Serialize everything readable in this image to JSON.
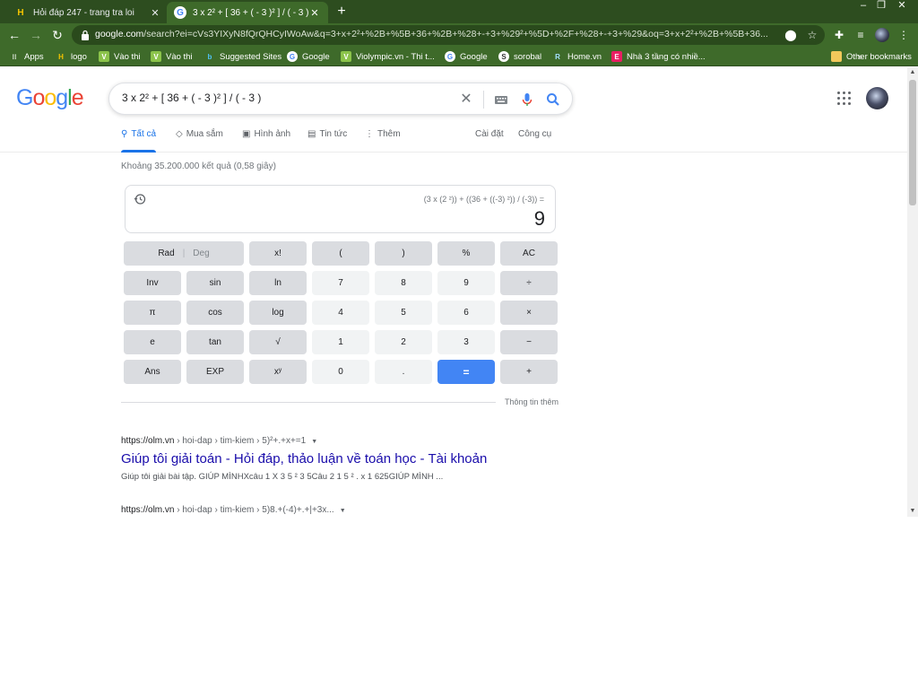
{
  "browser": {
    "tabs": [
      {
        "title": "Hỏi đáp 247 - trang tra loi",
        "favicon": "H"
      },
      {
        "title": "3 x 2² + [ 36 + ( - 3 )² ] / ( - 3 ) - T",
        "favicon": "G"
      }
    ],
    "window_controls": {
      "minimize": "–",
      "restore": "❐",
      "close": "✕"
    },
    "url_host": "google.com",
    "url_rest": "/search?ei=cVs3YIXyN8fQrQHCyIWoAw&q=3+x+2²+%2B+%5B+36+%2B+%28+-+3+%29²+%5D+%2F+%28+-+3+%29&oq=3+x+2²+%2B+%5B+36...",
    "bookmarks": [
      {
        "label": "Apps",
        "icon": "apps-icon"
      },
      {
        "label": "logo",
        "icon": "H"
      },
      {
        "label": "Vào thi",
        "icon": "V"
      },
      {
        "label": "Vào thi",
        "icon": "V"
      },
      {
        "label": "Suggested Sites",
        "icon": "b"
      },
      {
        "label": "Google",
        "icon": "G"
      },
      {
        "label": "Violympic.vn - Thi t...",
        "icon": "V"
      },
      {
        "label": "Google",
        "icon": "G"
      },
      {
        "label": "sorobal",
        "icon": "S"
      },
      {
        "label": "Home.vn",
        "icon": "R"
      },
      {
        "label": "Nhà 3 tầng có nhiề...",
        "icon": "E"
      }
    ],
    "bookmarks_overflow": "»",
    "other_bookmarks": "Other bookmarks"
  },
  "google": {
    "logo": [
      "G",
      "o",
      "o",
      "g",
      "l",
      "e"
    ],
    "logo_colors": [
      "#4285f4",
      "#ea4335",
      "#fbbc05",
      "#4285f4",
      "#34a853",
      "#ea4335"
    ],
    "query": "3 x 2² + [ 36 + ( - 3 )² ] / ( - 3 )",
    "tabs": [
      {
        "label": "Tất cả",
        "icon": "search-icon"
      },
      {
        "label": "Mua sắm",
        "icon": "tag-icon"
      },
      {
        "label": "Hình ảnh",
        "icon": "image-icon"
      },
      {
        "label": "Tin tức",
        "icon": "news-icon"
      },
      {
        "label": "Thêm",
        "icon": "more-vert-icon"
      }
    ],
    "settings": "Cài đặt",
    "tools": "Công cụ",
    "result_stats": "Khoảng 35.200.000 kết quả (0,58 giây)"
  },
  "calculator": {
    "expression": "(3 x (2 ²)) + ((36 + ((-3) ²)) / (-3)) =",
    "result": "9",
    "keys": [
      [
        "Rad | Deg",
        "x!",
        "(",
        ")",
        "%",
        "AC"
      ],
      [
        "Inv",
        "sin",
        "ln",
        "7",
        "8",
        "9",
        "÷"
      ],
      [
        "π",
        "cos",
        "log",
        "4",
        "5",
        "6",
        "×"
      ],
      [
        "e",
        "tan",
        "√",
        "1",
        "2",
        "3",
        "−"
      ],
      [
        "Ans",
        "EXP",
        "xʸ",
        "0",
        ".",
        "=",
        "+"
      ]
    ],
    "key_rad": "Rad",
    "key_deg": "Deg",
    "more_info": "Thông tin thêm"
  },
  "results": [
    {
      "url": "https://olm.vn",
      "breadcrumb": " › hoi-dap › tim-kiem › 5)²+.+x+=1",
      "title": "Giúp tôi giải toán - Hỏi đáp, thảo luận về toán học - Tài khoản",
      "snippet": "Giúp tôi giải bài tập. GIÚP MÌNHXcâu 1 X 3 5 ² 3 5Câu 2 1 5 ² . x 1 625GIÚP MÌNH ..."
    },
    {
      "url": "https://olm.vn",
      "breadcrumb": " › hoi-dap › tim-kiem › 5)8.+(-4)+.+|+3x...",
      "title": "",
      "snippet": ""
    }
  ]
}
